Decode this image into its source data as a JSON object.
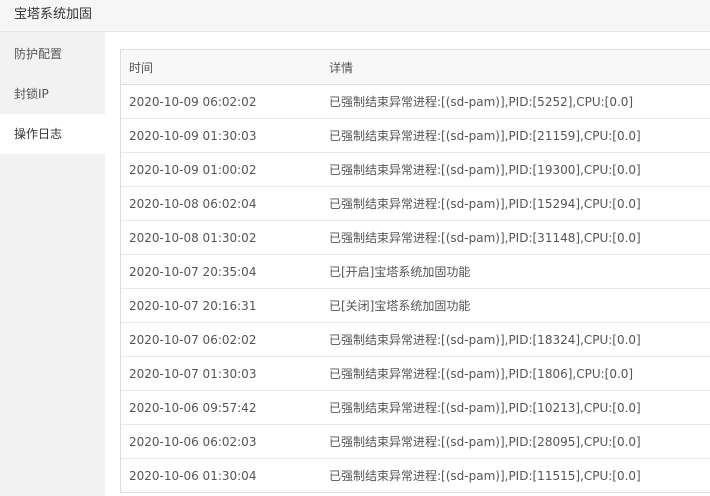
{
  "window": {
    "title": "宝塔系统加固"
  },
  "sidebar": {
    "items": [
      {
        "label": "防护配置",
        "active": false
      },
      {
        "label": "封锁IP",
        "active": false
      },
      {
        "label": "操作日志",
        "active": true
      }
    ]
  },
  "log_table": {
    "headers": {
      "time": "时间",
      "detail": "详情"
    },
    "rows": [
      {
        "time": "2020-10-09 06:02:02",
        "detail": "已强制结束异常进程:[(sd-pam)],PID:[5252],CPU:[0.0]"
      },
      {
        "time": "2020-10-09 01:30:03",
        "detail": "已强制结束异常进程:[(sd-pam)],PID:[21159],CPU:[0.0]"
      },
      {
        "time": "2020-10-09 01:00:02",
        "detail": "已强制结束异常进程:[(sd-pam)],PID:[19300],CPU:[0.0]"
      },
      {
        "time": "2020-10-08 06:02:04",
        "detail": "已强制结束异常进程:[(sd-pam)],PID:[15294],CPU:[0.0]"
      },
      {
        "time": "2020-10-08 01:30:02",
        "detail": "已强制结束异常进程:[(sd-pam)],PID:[31148],CPU:[0.0]"
      },
      {
        "time": "2020-10-07 20:35:04",
        "detail": "已[开启]宝塔系统加固功能"
      },
      {
        "time": "2020-10-07 20:16:31",
        "detail": "已[关闭]宝塔系统加固功能"
      },
      {
        "time": "2020-10-07 06:02:02",
        "detail": "已强制结束异常进程:[(sd-pam)],PID:[18324],CPU:[0.0]"
      },
      {
        "time": "2020-10-07 01:30:03",
        "detail": "已强制结束异常进程:[(sd-pam)],PID:[1806],CPU:[0.0]"
      },
      {
        "time": "2020-10-06 09:57:42",
        "detail": "已强制结束异常进程:[(sd-pam)],PID:[10213],CPU:[0.0]"
      },
      {
        "time": "2020-10-06 06:02:03",
        "detail": "已强制结束异常进程:[(sd-pam)],PID:[28095],CPU:[0.0]"
      },
      {
        "time": "2020-10-06 01:30:04",
        "detail": "已强制结束异常进程:[(sd-pam)],PID:[11515],CPU:[0.0]"
      }
    ]
  }
}
